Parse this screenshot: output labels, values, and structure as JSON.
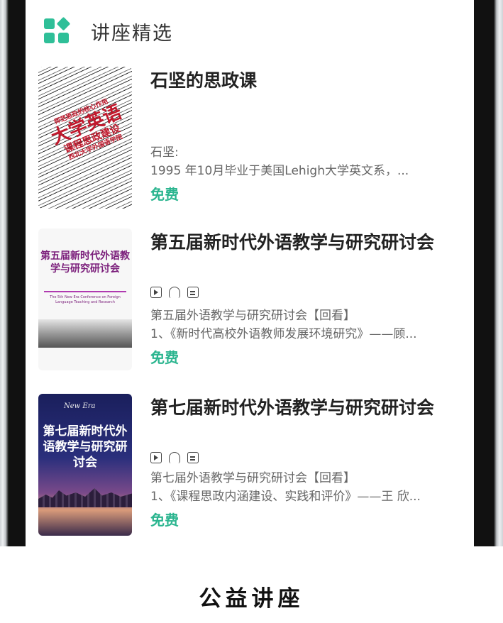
{
  "header": {
    "title": "讲座精选",
    "icon": "grid-apps-icon",
    "accent_color": "#2fbf98"
  },
  "lectures": [
    {
      "title": "石坚的思政课",
      "subtitle": "石坚:",
      "description": "1995 年10月毕业于美国Lehigh大学英文系，...",
      "price": "免费",
      "cover": {
        "main": "大学英语",
        "secondary": "课程思政建设",
        "top_line": "师范思政的核心作用",
        "bottom_line": "西北大学外国语学院"
      },
      "has_media_icons": false
    },
    {
      "title": "第五届新时代外语教学与研究研讨会",
      "subtitle": "第五届外语教学与研究研讨会【回看】",
      "description": "1、《新时代高校外语教师发展环境研究》——顾...",
      "price": "免费",
      "cover": {
        "main": "第五届新时代外语教学与研究研讨会",
        "english": "The 5th New Era Conference on Foreign Language Teaching and Research"
      },
      "has_media_icons": true
    },
    {
      "title": "第七届新时代外语教学与研究研讨会",
      "subtitle": "第七届外语教学与研究研讨会【回看】",
      "description": "1、《课程思政内涵建设、实践和评价》——王 欣...",
      "price": "免费",
      "cover": {
        "brand": "New Era",
        "main": "第七届新时代外语教学与研究研讨会"
      },
      "has_media_icons": true
    }
  ],
  "media_icons": [
    "video-icon",
    "audio-icon",
    "text-icon"
  ],
  "caption": "公益讲座",
  "colors": {
    "price_green": "#2bb58f",
    "title_text": "#222222",
    "sub_text": "#666666"
  }
}
